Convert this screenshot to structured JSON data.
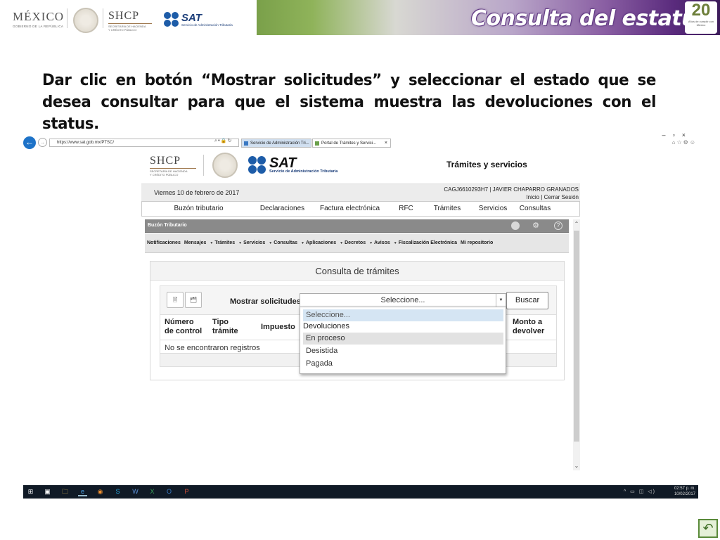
{
  "slide": {
    "header": {
      "mexico": "MÉXICO",
      "mexico_sub": "GOBIERNO DE LA REPÚBLICA",
      "shcp": "SHCP",
      "shcp_sub1": "SECRETARÍA DE HACIENDA",
      "shcp_sub2": "Y CRÉDITO PÚBLICO",
      "sat": "SAT",
      "sat_sub": "Servicio de Administración Tributaria",
      "title": "Consulta del estatus",
      "anniversary_number": "20",
      "anniversary_text": "Años de cumplir con México"
    },
    "instruction": "Dar clic en botón “Mostrar solicitudes” y seleccionar el estado que se desea consultar para que el sistema muestra las devoluciones con el status.",
    "return_icon": "return-arrow-icon"
  },
  "browser": {
    "url": "https://www.sat.gob.mx/PTSC/",
    "tabs": [
      {
        "label": "Servicio de Administración Tri..."
      },
      {
        "label": "Portal de Trámites y Servici..."
      }
    ]
  },
  "site": {
    "shcp": "SHCP",
    "shcp_sub1": "SECRETARÍA DE HACIENDA",
    "shcp_sub2": "Y CRÉDITO PÚBLICO",
    "sat": "SAT",
    "sat_sub": "Servicio de Administración Tributaria",
    "section_title": "Trámites y servicios",
    "date": "Viernes 10 de febrero de 2017",
    "user": "CAGJ6610293H7 | JAVIER CHAPARRO GRANADOS",
    "user_links": "Inicio | Cerrar Sesión",
    "nav": [
      "Buzón tributario",
      "Declaraciones",
      "Factura electrónica",
      "RFC",
      "Trámites",
      "Servicios",
      "Consultas"
    ]
  },
  "buzon": {
    "title": "Buzón Tributario",
    "menu": [
      {
        "label": "Notificaciones",
        "arrow": false
      },
      {
        "label": "Mensajes",
        "arrow": false
      },
      {
        "label": "Trámites",
        "arrow": true
      },
      {
        "label": "Servicios",
        "arrow": true
      },
      {
        "label": "Consultas",
        "arrow": true
      },
      {
        "label": "Aplicaciones",
        "arrow": true
      },
      {
        "label": "Decretos",
        "arrow": true
      },
      {
        "label": "Avisos",
        "arrow": true
      },
      {
        "label": "Fiscalización Electrónica",
        "arrow": true
      },
      {
        "label": "Mi repositorio",
        "arrow": false
      }
    ]
  },
  "consulta": {
    "title": "Consulta de trámites",
    "mostrar_label": "Mostrar solicitudes:",
    "select_value": "Seleccione...",
    "buscar": "Buscar",
    "columns": {
      "numero1": "Número",
      "numero2": "de control",
      "tipo1": "Tipo",
      "tipo2": "trámite",
      "impuesto": "Impuesto",
      "monto1": "Monto a",
      "monto2": "devolver"
    },
    "empty": "No se encontraron registros",
    "dropdown": {
      "placeholder": "Seleccione...",
      "group": "Devoluciones",
      "options": [
        "En proceso",
        "Desistida",
        "Pagada"
      ]
    }
  },
  "taskbar": {
    "time": "02:57 p. m.",
    "date": "10/02/2017"
  },
  "colors": {
    "sat_blue": "#1d5ca8",
    "title_bar": "#8a8a8a",
    "selected_option": "#d5e5f3",
    "hover_option": "#e2e2e2"
  }
}
